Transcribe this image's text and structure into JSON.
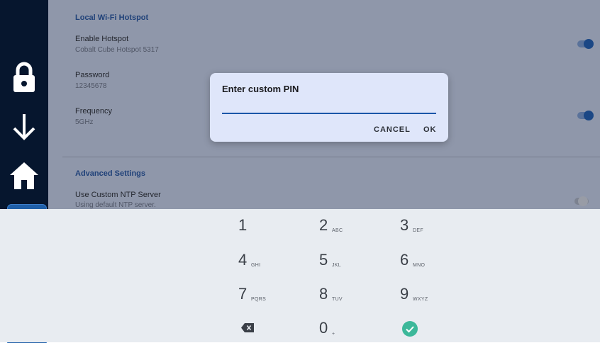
{
  "settings": {
    "hotspot_section": "Local Wi-Fi Hotspot",
    "enable_hotspot": {
      "title": "Enable Hotspot",
      "subtitle": "Cobalt Cube Hotspot 5317",
      "on": true
    },
    "password": {
      "title": "Password",
      "value": "12345678"
    },
    "frequency": {
      "title": "Frequency",
      "value": "5GHz",
      "on": true
    },
    "advanced_section": "Advanced Settings",
    "ntp": {
      "title": "Use Custom NTP Server",
      "subtitle": "Using default NTP server.",
      "on": false
    }
  },
  "dialog": {
    "title": "Enter custom PIN",
    "input_value": "",
    "cancel_label": "CANCEL",
    "ok_label": "OK"
  },
  "keypad": {
    "keys": [
      {
        "digit": "1",
        "letters": ""
      },
      {
        "digit": "2",
        "letters": "ABC"
      },
      {
        "digit": "3",
        "letters": "DEF"
      },
      {
        "digit": "4",
        "letters": "GHI"
      },
      {
        "digit": "5",
        "letters": "JKL"
      },
      {
        "digit": "6",
        "letters": "MNO"
      },
      {
        "digit": "7",
        "letters": "PQRS"
      },
      {
        "digit": "8",
        "letters": "TUV"
      },
      {
        "digit": "9",
        "letters": "WXYZ"
      },
      {
        "digit": "0",
        "letters": "+"
      }
    ],
    "backspace_icon": "backspace-icon",
    "done_icon": "check-circle-icon"
  },
  "rail": {
    "icons": [
      "lock-icon",
      "download-arrow-icon",
      "home-icon",
      "alarm-siren-icon",
      "alarm-siren-icon",
      "computer-monitor-icon"
    ]
  },
  "colors": {
    "accent": "#1259b6",
    "rail_bg": "#06162e",
    "done_green": "#3cb89a"
  }
}
